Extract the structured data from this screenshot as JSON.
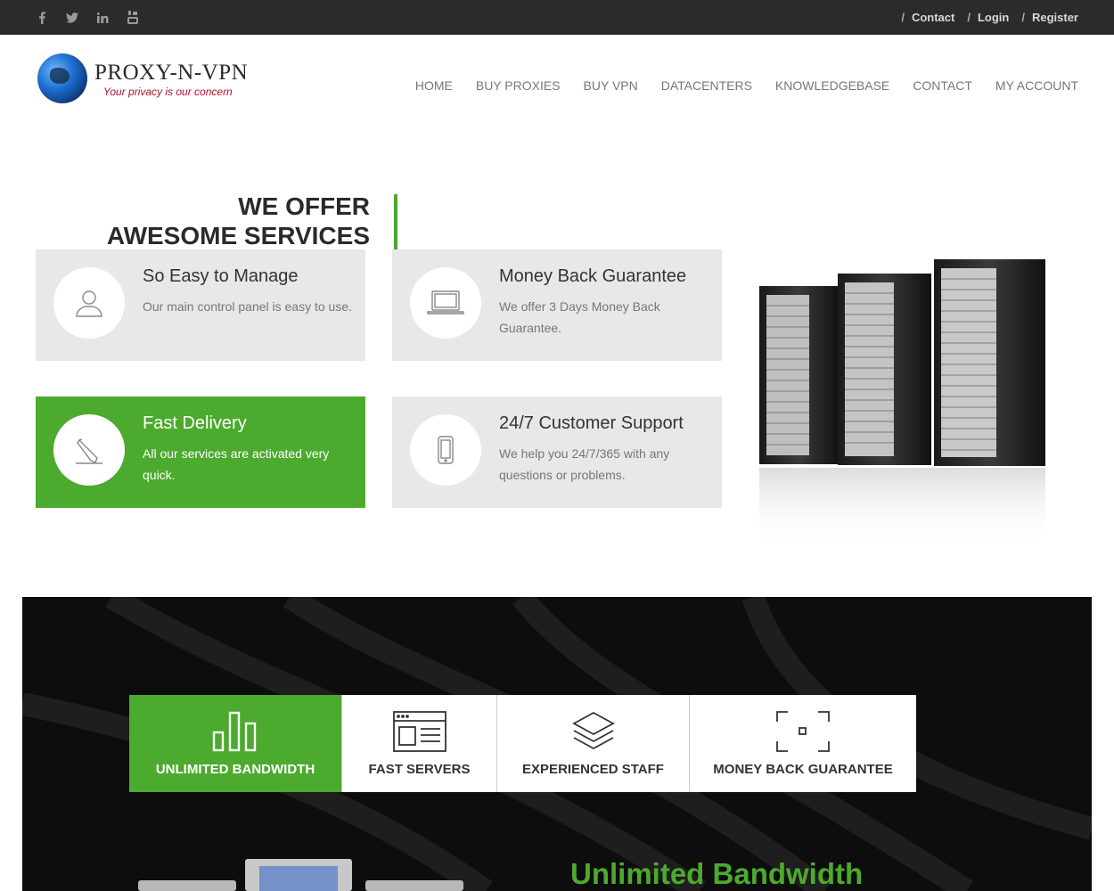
{
  "topbar": {
    "social": [
      {
        "name": "facebook-icon",
        "glyph": "f"
      },
      {
        "name": "twitter-icon",
        "glyph": "t"
      },
      {
        "name": "linkedin-icon",
        "glyph": "in"
      },
      {
        "name": "youtube-icon",
        "glyph": "You"
      }
    ],
    "links": [
      "Contact",
      "Login",
      "Register"
    ],
    "separator": "/"
  },
  "logo": {
    "brand": "PROXY-N-VPN",
    "tagline": "Your privacy is our concern"
  },
  "nav": [
    "HOME",
    "BUY PROXIES",
    "BUY VPN",
    "DATACENTERS",
    "KNOWLEDGEBASE",
    "CONTACT",
    "MY ACCOUNT"
  ],
  "services": {
    "heading_line1": "WE OFFER",
    "heading_line2": "AWESOME SERVICES",
    "cards": [
      {
        "title": "So Easy to Manage",
        "desc": "Our main control panel is easy to use.",
        "icon": "user-icon"
      },
      {
        "title": "Money Back Guarantee",
        "desc": "We offer 3 Days Money Back Guarantee.",
        "icon": "laptop-icon"
      },
      {
        "title": "Fast Delivery",
        "desc": "All our services are activated very quick.",
        "icon": "pencil-icon"
      },
      {
        "title": "24/7 Customer Support",
        "desc": "We help you 24/7/365 with any questions or problems.",
        "icon": "mobile-icon"
      }
    ]
  },
  "features": {
    "tabs": [
      {
        "label": "UNLIMITED BANDWIDTH",
        "icon": "bar-chart-icon",
        "active": true
      },
      {
        "label": "FAST SERVERS",
        "icon": "browser-window-icon",
        "active": false
      },
      {
        "label": "EXPERIENCED STAFF",
        "icon": "layers-icon",
        "active": false
      },
      {
        "label": "MONEY BACK GUARANTEE",
        "icon": "focus-frame-icon",
        "active": false
      }
    ],
    "section_title": "Unlimited Bandwidth"
  },
  "colors": {
    "accent": "#4caa2e",
    "topbar": "#2b2b2b",
    "card": "#e8e8e8"
  }
}
